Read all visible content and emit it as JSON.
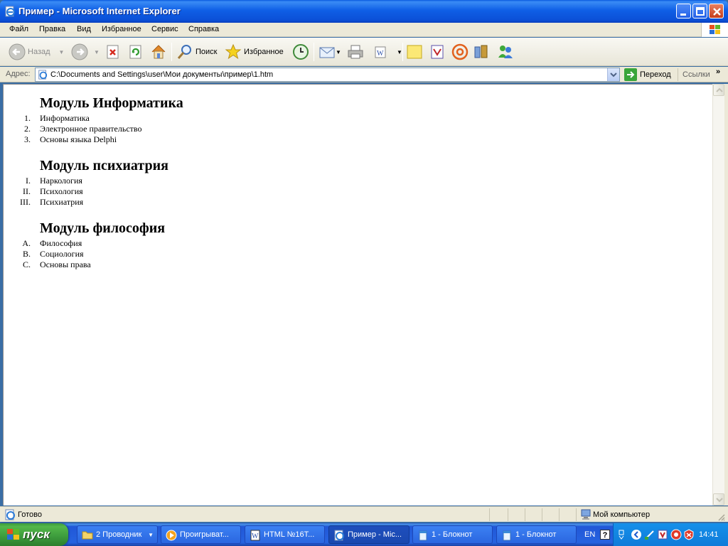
{
  "window": {
    "title": "Пример - Microsoft Internet Explorer"
  },
  "menu": {
    "items": [
      "Файл",
      "Правка",
      "Вид",
      "Избранное",
      "Сервис",
      "Справка"
    ]
  },
  "toolbar": {
    "back_label": "Назад",
    "search_label": "Поиск",
    "favorites_label": "Избранное"
  },
  "address": {
    "label": "Адрес:",
    "value": "C:\\Documents and Settings\\user\\Мои документы\\пример\\1.htm",
    "go_label": "Переход",
    "links_label": "Ссылки"
  },
  "content": {
    "sections": [
      {
        "heading": "Модуль Информатика",
        "markers": [
          "1.",
          "2.",
          "3."
        ],
        "items": [
          "Информатика",
          "Электронное правительство",
          "Основы языка Delphi"
        ]
      },
      {
        "heading": "Модуль психиатрия",
        "markers": [
          "I.",
          "II.",
          "III."
        ],
        "items": [
          "Наркология",
          "Психология",
          "Психиатрия"
        ]
      },
      {
        "heading": "Модуль философия",
        "markers": [
          "A.",
          "B.",
          "C."
        ],
        "items": [
          "Философия",
          "Социология",
          "Основы права"
        ]
      }
    ]
  },
  "status": {
    "text": "Готово",
    "zone": "Мой компьютер"
  },
  "taskbar": {
    "start_label": "пуск",
    "tasks": [
      "2 Проводник",
      "Проигрыват...",
      "HTML №16Т...",
      "Пример - Mic...",
      "1 - Блокнот",
      "1 - Блокнот"
    ],
    "lang": "EN",
    "help": "?",
    "clock": "14:41"
  }
}
